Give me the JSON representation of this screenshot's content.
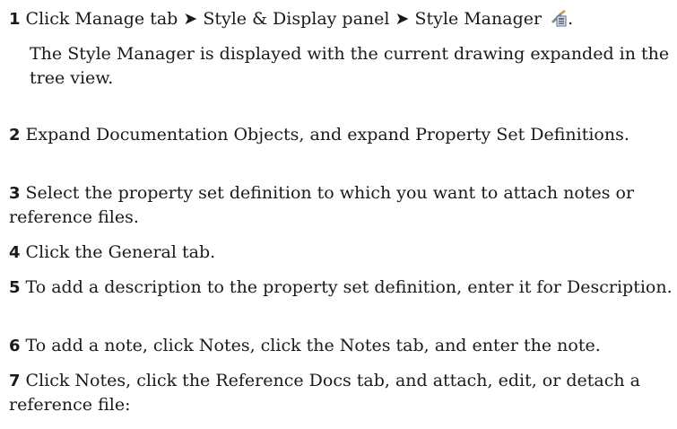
{
  "steps": [
    {
      "number": "1",
      "text": "Click Manage tab ➤ Style & Display panel ➤ Style Manager",
      "trailing": ".",
      "icon": "style-manager-icon"
    },
    {
      "note": "The Style Manager is displayed with the current drawing expanded in the tree view."
    },
    {
      "number": "2",
      "text": "Expand Documentation Objects, and expand Property Set Definitions."
    },
    {
      "number": "3",
      "text": "Select the property set definition to which you want to attach notes or reference files."
    },
    {
      "number": "4",
      "text": "Click the General tab."
    },
    {
      "number": "5",
      "text": "To add a description to the property set definition, enter it for Description."
    },
    {
      "number": "6",
      "text": "To add a note, click Notes, click the Notes tab, and enter the note."
    },
    {
      "number": "7",
      "text": "Click Notes, click the Reference Docs tab, and attach, edit, or detach a reference file:"
    }
  ]
}
